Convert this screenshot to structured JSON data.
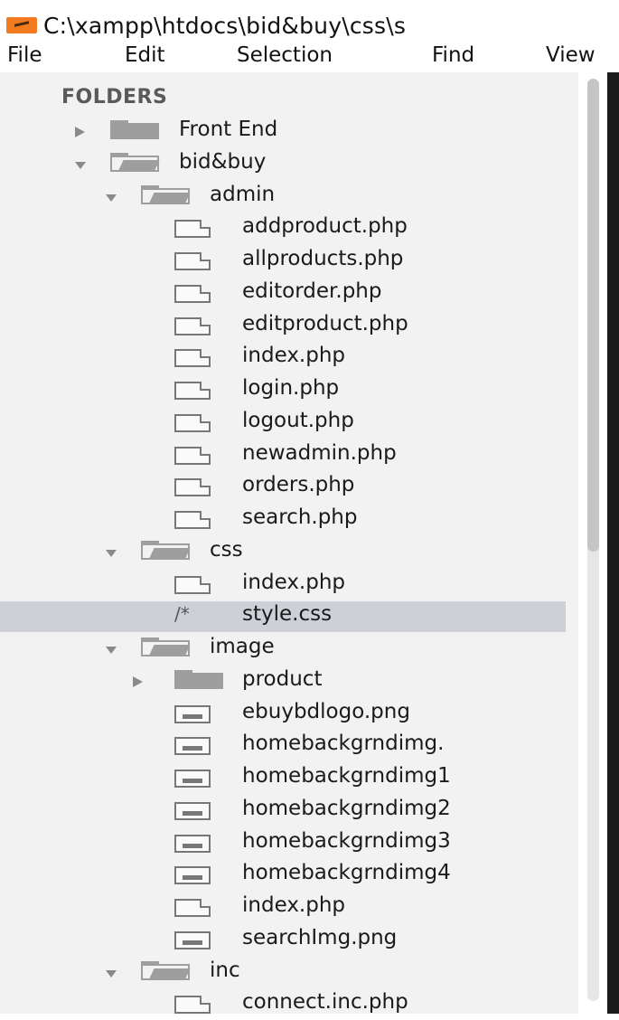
{
  "window": {
    "title": "C:\\xampp\\htdocs\\bid&buy\\css\\s"
  },
  "menu": [
    "File",
    "Edit",
    "Selection",
    "Find",
    "View"
  ],
  "sidebar": {
    "heading": "FOLDERS",
    "selected_item": "style.css",
    "items": [
      {
        "label": "Front End",
        "type": "folder",
        "state": "collapsed",
        "depth": 0
      },
      {
        "label": "bid&buy",
        "type": "folder",
        "state": "expanded",
        "depth": 0
      },
      {
        "label": "admin",
        "type": "folder",
        "state": "expanded",
        "depth": 1
      },
      {
        "label": "addproduct.php",
        "type": "file",
        "depth": 2
      },
      {
        "label": "allproducts.php",
        "type": "file",
        "depth": 2
      },
      {
        "label": "editorder.php",
        "type": "file",
        "depth": 2
      },
      {
        "label": "editproduct.php",
        "type": "file",
        "depth": 2
      },
      {
        "label": "index.php",
        "type": "file",
        "depth": 2
      },
      {
        "label": "login.php",
        "type": "file",
        "depth": 2
      },
      {
        "label": "logout.php",
        "type": "file",
        "depth": 2
      },
      {
        "label": "newadmin.php",
        "type": "file",
        "depth": 2
      },
      {
        "label": "orders.php",
        "type": "file",
        "depth": 2
      },
      {
        "label": "search.php",
        "type": "file",
        "depth": 2
      },
      {
        "label": "css",
        "type": "folder",
        "state": "expanded",
        "depth": 1
      },
      {
        "label": "index.php",
        "type": "file",
        "depth": 2
      },
      {
        "label": "style.css",
        "type": "css",
        "depth": 2,
        "glyph": "/*"
      },
      {
        "label": "image",
        "type": "folder",
        "state": "expanded",
        "depth": 1
      },
      {
        "label": "product",
        "type": "folder",
        "state": "collapsed",
        "depth": 2
      },
      {
        "label": "ebuybdlogo.png",
        "type": "image",
        "depth": 2
      },
      {
        "label": "homebackgrndimg.",
        "type": "image",
        "depth": 2
      },
      {
        "label": "homebackgrndimg1",
        "type": "image",
        "depth": 2
      },
      {
        "label": "homebackgrndimg2",
        "type": "image",
        "depth": 2
      },
      {
        "label": "homebackgrndimg3",
        "type": "image",
        "depth": 2
      },
      {
        "label": "homebackgrndimg4",
        "type": "image",
        "depth": 2
      },
      {
        "label": "index.php",
        "type": "file",
        "depth": 2
      },
      {
        "label": "searchImg.png",
        "type": "image",
        "depth": 2
      },
      {
        "label": "inc",
        "type": "folder",
        "state": "expanded",
        "depth": 1
      },
      {
        "label": "connect.inc.php",
        "type": "file",
        "depth": 2
      }
    ]
  },
  "colors": {
    "accent": "#f37a1f",
    "sidebar_bg": "#f2f2f2",
    "selected_bg": "#cdd0d6",
    "editor_bg": "#1b1b1b"
  }
}
